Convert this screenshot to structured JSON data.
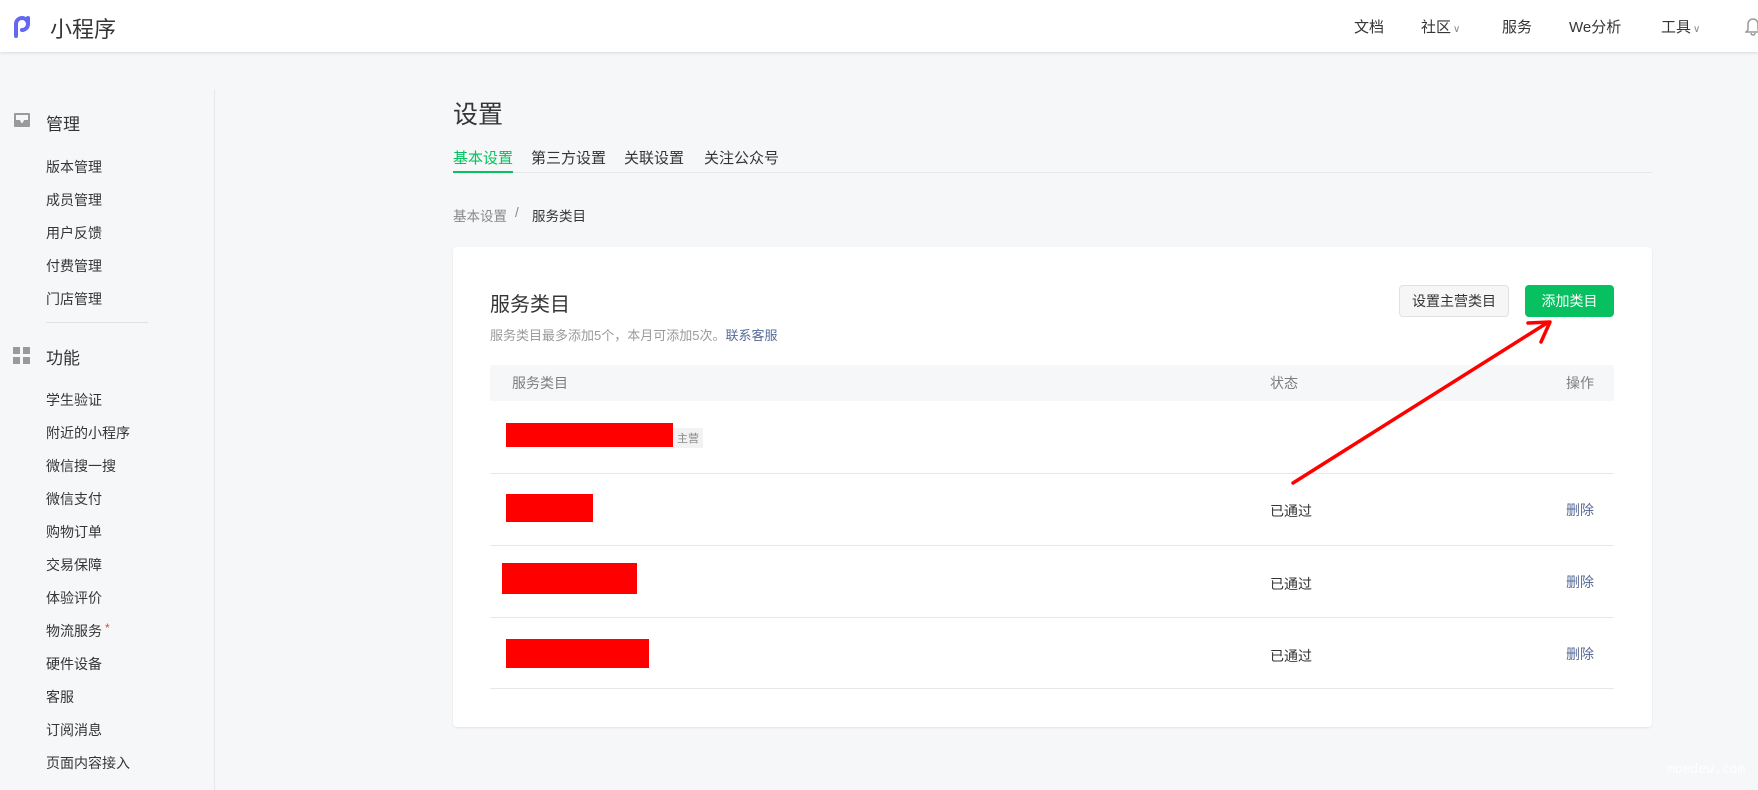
{
  "header": {
    "logo_text": "小程序",
    "nav": [
      {
        "label": "文档"
      },
      {
        "label": "社区",
        "dropdown": true
      },
      {
        "label": "服务"
      },
      {
        "label": "We分析"
      },
      {
        "label": "工具",
        "dropdown": true
      }
    ],
    "chevron": "∨"
  },
  "sidebar": {
    "sections": [
      {
        "title": "管理",
        "icon": "inbox-icon",
        "items": [
          "版本管理",
          "成员管理",
          "用户反馈",
          "付费管理",
          "门店管理"
        ]
      },
      {
        "title": "功能",
        "icon": "grid-icon",
        "items": [
          "学生验证",
          "附近的小程序",
          "微信搜一搜",
          "微信支付",
          "购物订单",
          "交易保障",
          "体验评价",
          "物流服务",
          "硬件设备",
          "客服",
          "订阅消息",
          "页面内容接入"
        ]
      }
    ],
    "new_dot": "*"
  },
  "page": {
    "title": "设置",
    "tabs": [
      "基本设置",
      "第三方设置",
      "关联设置",
      "关注公众号"
    ],
    "active_tab": 0,
    "breadcrumb": [
      "基本设置",
      "/",
      "服务类目"
    ]
  },
  "card": {
    "title": "服务类目",
    "subtitle": "服务类目最多添加5个，本月可添加5次。",
    "contact_link": "联系客服",
    "btn_set_main": "设置主营类目",
    "btn_add": "添加类目",
    "columns": [
      "服务类目",
      "状态",
      "操作"
    ],
    "rows": [
      {
        "tag": "主营",
        "status": "",
        "action": ""
      },
      {
        "status": "已通过",
        "action": "删除"
      },
      {
        "status": "已通过",
        "action": "删除"
      },
      {
        "status": "已通过",
        "action": "删除"
      }
    ]
  },
  "watermark": "moedew.com",
  "colors": {
    "accent": "#07c160",
    "link": "#576b95",
    "redaction": "#ff0000"
  }
}
